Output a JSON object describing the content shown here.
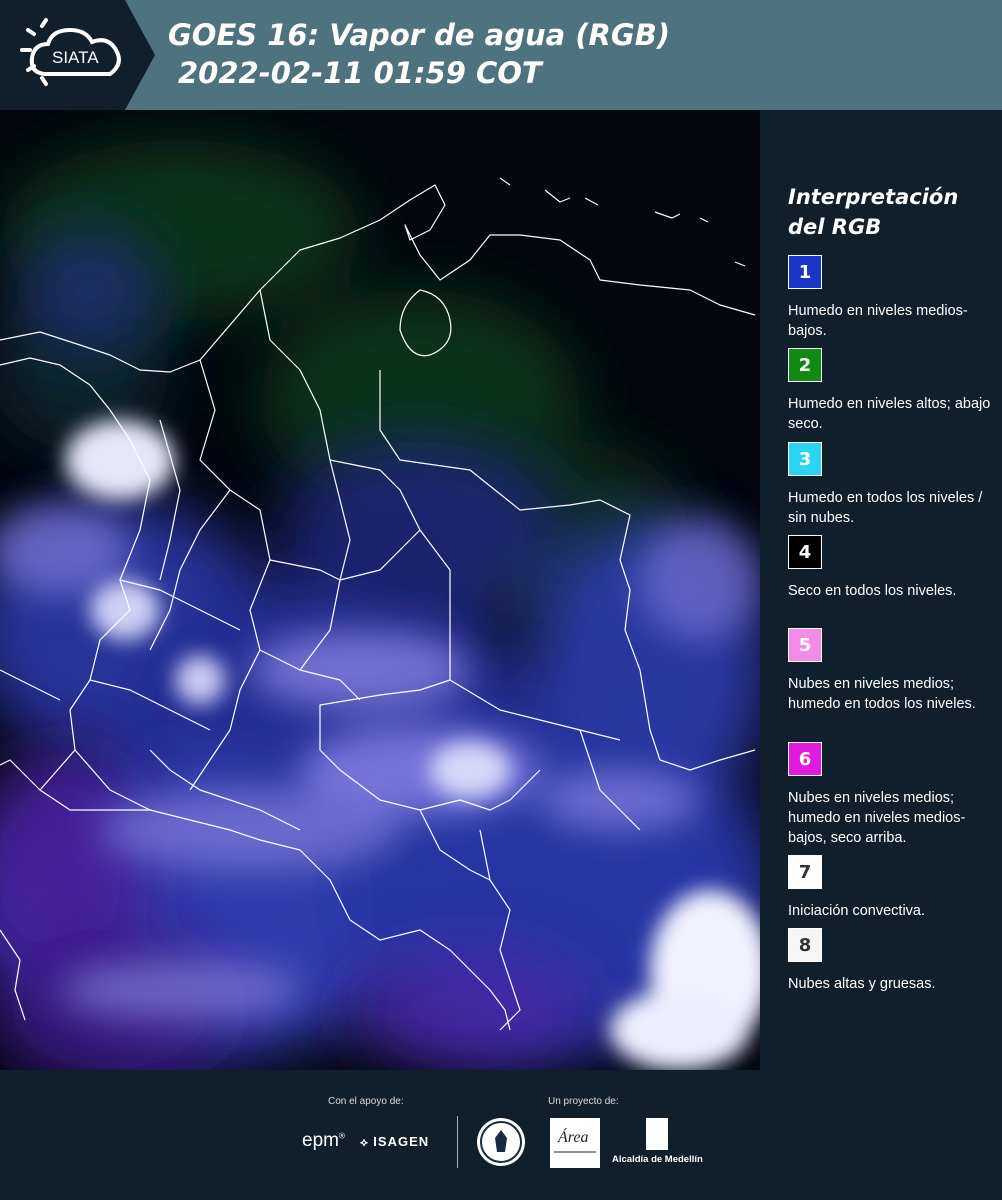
{
  "header": {
    "logo_text": "SIATA",
    "title_line1": "GOES 16: Vapor de agua (RGB)",
    "title_line2": "2022-02-11 01:59 COT"
  },
  "legend": {
    "title_line1": "Interpretación",
    "title_line2": "del RGB",
    "items": [
      {
        "number": "1",
        "color": "#1a35c7",
        "text_color": "#ffffff",
        "description": "Humedo en niveles medios-bajos."
      },
      {
        "number": "2",
        "color": "#118a12",
        "text_color": "#ffffff",
        "description": "Humedo en niveles altos; abajo seco."
      },
      {
        "number": "3",
        "color": "#2bd4f0",
        "text_color": "#ffffff",
        "description": "Humedo en todos los niveles / sin nubes."
      },
      {
        "number": "4",
        "color": "#000000",
        "text_color": "#ffffff",
        "description": "Seco en todos los niveles."
      },
      {
        "number": "5",
        "color": "#f28be8",
        "text_color": "#ffffff",
        "description": "Nubes en niveles medios; humedo en todos los niveles."
      },
      {
        "number": "6",
        "color": "#e11ae0",
        "text_color": "#ffffff",
        "description": "Nubes en niveles medios; humedo en niveles medios-bajos, seco arriba."
      },
      {
        "number": "7",
        "color": "#ffffff",
        "text_color": "#333333",
        "description": "Iniciación convectiva."
      },
      {
        "number": "8",
        "color": "#f6f6f6",
        "text_color": "#333333",
        "description": "Nubes altas y gruesas."
      }
    ]
  },
  "footer": {
    "support_label": "Con el apoyo de:",
    "project_label": "Un proyecto de:",
    "epm": "epm",
    "isagen": "ISAGEN",
    "medellin": "Alcaldía de Medellín"
  },
  "map": {
    "background": "#03060d",
    "border_color": "#ffffff"
  }
}
